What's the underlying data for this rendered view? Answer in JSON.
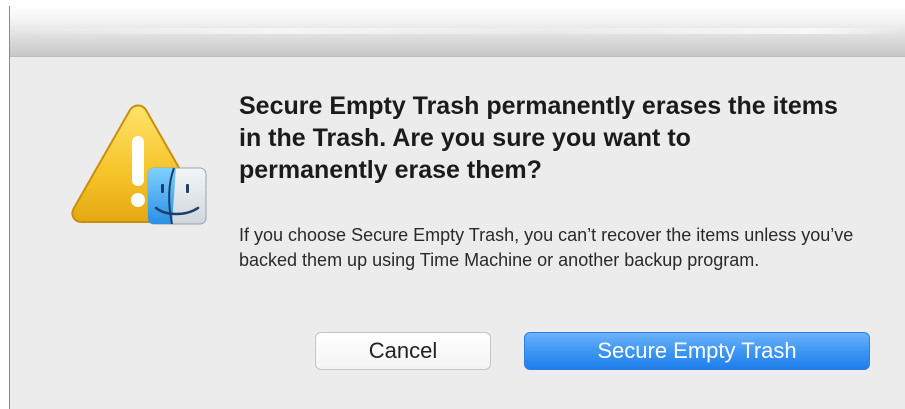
{
  "dialog": {
    "headline": "Secure Empty Trash permanently erases the items in the Trash. Are you sure you want to permanently erase them?",
    "body": "If you choose Secure Empty Trash, you can’t recover the items unless you’ve backed them up using Time Machine or another backup program.",
    "icon": "warning-icon",
    "badge_icon": "finder-icon"
  },
  "buttons": {
    "cancel_label": "Cancel",
    "confirm_label": "Secure Empty Trash"
  },
  "colors": {
    "dialog_background": "#ececec",
    "primary_button": "#3d97f4",
    "warning_yellow": "#f2c230"
  }
}
